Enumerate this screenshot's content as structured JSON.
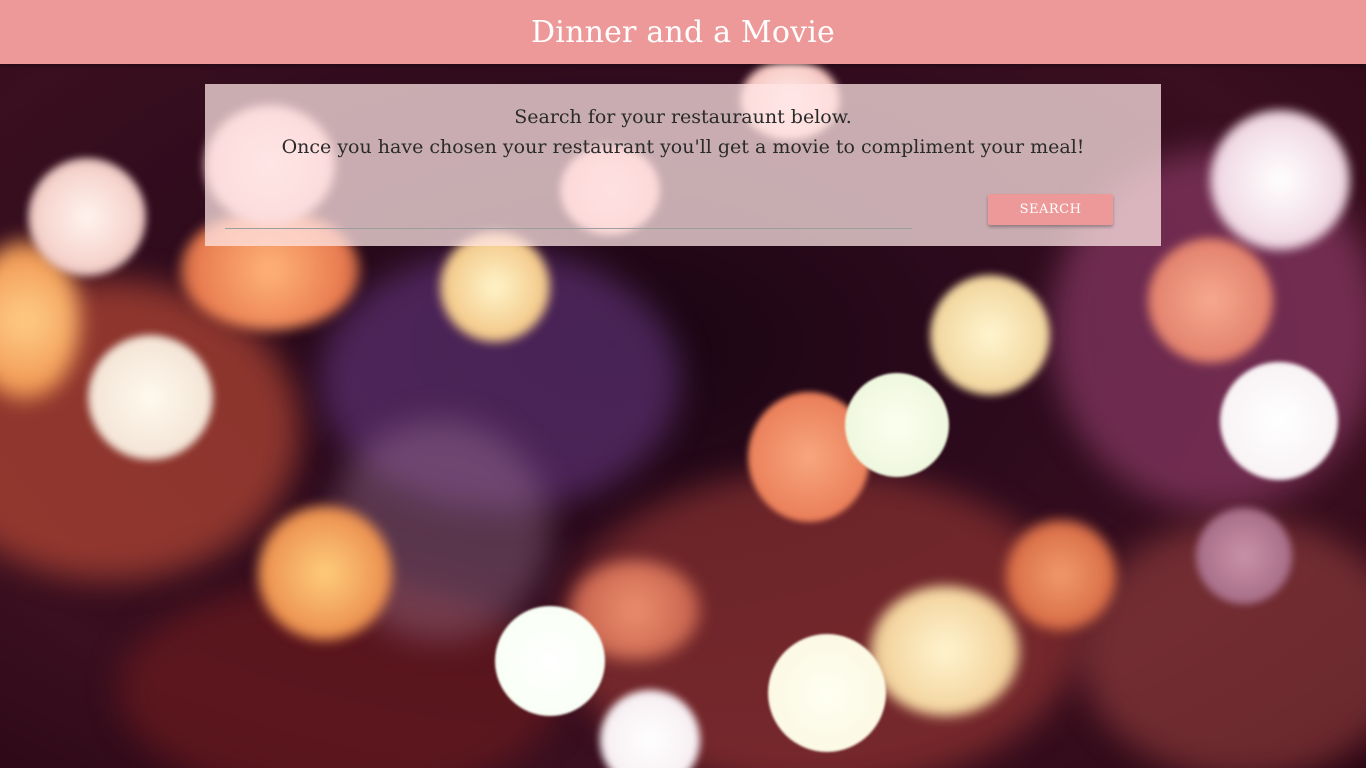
{
  "header": {
    "title": "Dinner and a Movie"
  },
  "search_card": {
    "intro_line1": "Search for your restauraunt below.",
    "intro_line2": "Once you have chosen your restaurant you'll get a movie to compliment your meal!",
    "input_value": "",
    "input_placeholder": "",
    "button_label": "Search"
  },
  "colors": {
    "header_bg": "#ee9999",
    "button_bg": "#ee9999",
    "card_bg": "rgba(255,230,230,0.74)",
    "text": "#2a2a2a"
  }
}
